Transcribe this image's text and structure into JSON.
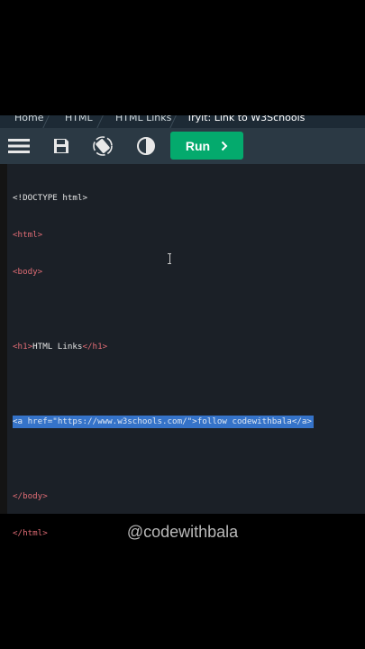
{
  "breadcrumb": {
    "items": [
      "Home",
      "HTML",
      "HTML Links",
      "Tryit: Link to W3Schools"
    ]
  },
  "toolbar": {
    "menu_icon": "hamburger-menu-icon",
    "save_icon": "floppy-disk-icon",
    "rotate_icon": "rotate-orientation-icon",
    "theme_icon": "contrast-theme-icon",
    "run_label": "Run",
    "run_color": "#04aa6d"
  },
  "code": {
    "doctype": "<!DOCTYPE html>",
    "html_open": "<html>",
    "body_open": "<body>",
    "h1_open": "<h1>",
    "h1_text": "HTML Links",
    "h1_close": "</h1>",
    "a_open_start": "<a ",
    "a_attr": "href=",
    "a_url": "\"https://www.w3schools.com/\"",
    "a_open_end": ">",
    "a_text": "follow codewithbala",
    "a_close": "</a>",
    "body_close": "</body>",
    "html_close": "</html>"
  },
  "watermark": "@codewithbala"
}
